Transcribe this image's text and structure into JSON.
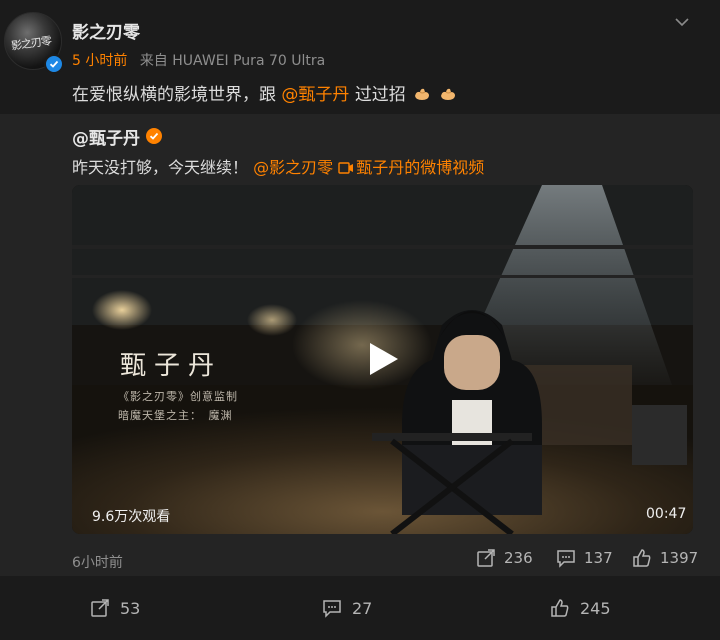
{
  "post": {
    "author": "影之刃零",
    "time": "5 小时前",
    "source": "来自 HUAWEI Pura 70 Ultra",
    "text_before": "在爱恨纵横的影境世界，跟",
    "mention": "@甄子丹",
    "text_after": "过过招",
    "avatar_text": "影之刃零"
  },
  "repost": {
    "author": "@甄子丹",
    "text": "昨天没打够，今天继续！",
    "mention": "@影之刃零",
    "video_link": "甄子丹的微博视频",
    "video": {
      "name": "甄子丹",
      "role_line1": "《影之刃零》创意监制",
      "role_line2": "暗魔天堡之主：　魔渊",
      "views": "9.6万次观看",
      "duration": "00:47"
    },
    "time": "6小时前",
    "shares": "236",
    "comments": "137",
    "likes": "1397"
  },
  "actions": {
    "shares": "53",
    "comments": "27",
    "likes": "245"
  },
  "colors": {
    "accent": "#ff8200",
    "verified": "#1e88e5",
    "background": "#1b1b1b",
    "repost_background": "#242424"
  },
  "icons": [
    "chevron-down-icon",
    "verified-icon",
    "gold-badge-icon",
    "video-link-icon",
    "play-icon",
    "share-icon",
    "comment-icon",
    "like-icon",
    "flex-emoji-icon"
  ]
}
